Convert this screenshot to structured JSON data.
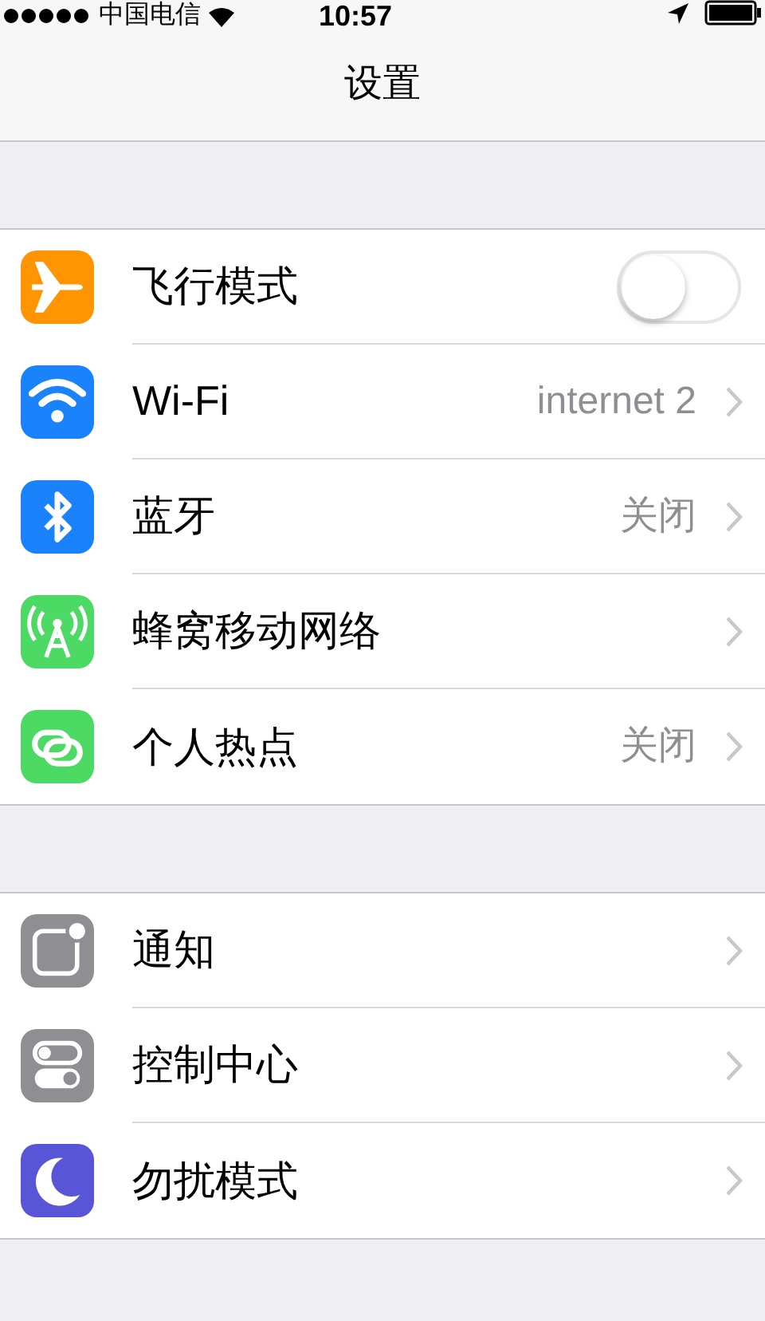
{
  "status_bar": {
    "carrier": "中国电信",
    "time": "10:57"
  },
  "nav_bar": {
    "title": "设置"
  },
  "sections": [
    {
      "rows": [
        {
          "kind": "toggle",
          "label": "飞行模式",
          "on": false
        },
        {
          "kind": "disclosure",
          "label": "Wi-Fi",
          "value": "internet 2"
        },
        {
          "kind": "disclosure",
          "label": "蓝牙",
          "value": "关闭"
        },
        {
          "kind": "disclosure",
          "label": "蜂窝移动网络"
        },
        {
          "kind": "disclosure",
          "label": "个人热点",
          "value": "关闭"
        }
      ]
    },
    {
      "rows": [
        {
          "kind": "disclosure",
          "label": "通知"
        },
        {
          "kind": "disclosure",
          "label": "控制中心"
        },
        {
          "kind": "disclosure",
          "label": "勿扰模式"
        }
      ]
    }
  ]
}
